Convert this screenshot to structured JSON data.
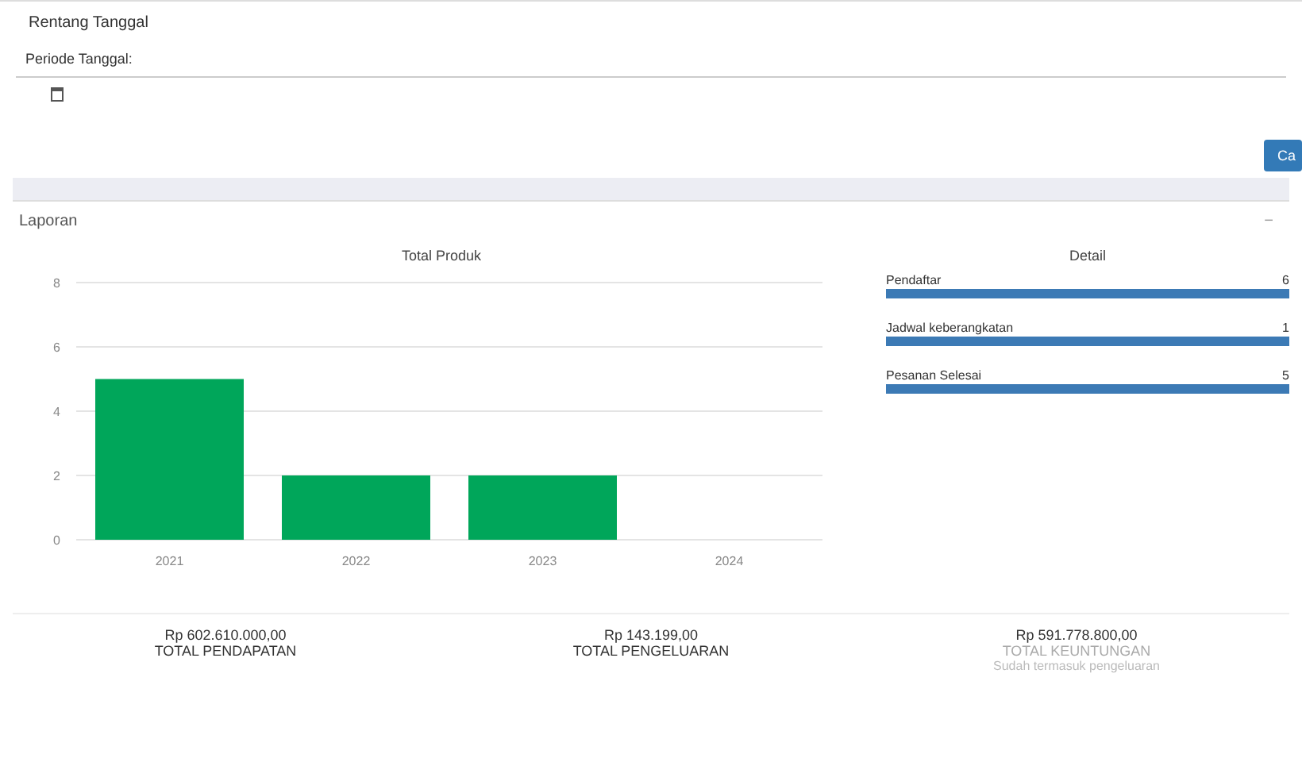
{
  "filter": {
    "title": "Rentang Tanggal",
    "label": "Periode Tanggal:",
    "button": "Ca"
  },
  "report": {
    "title": "Laporan",
    "collapse": "−",
    "chart": {
      "chart_data": {
        "type": "bar",
        "title": "Total Produk",
        "categories": [
          "2021",
          "2022",
          "2023",
          "2024"
        ],
        "values": [
          5,
          2,
          2,
          0
        ],
        "ylim": [
          0,
          8
        ],
        "yticks": [
          0,
          2,
          4,
          6,
          8
        ],
        "grid": true
      }
    },
    "detail": {
      "title": "Detail",
      "items": [
        {
          "label": "Pendaftar",
          "value": "6",
          "level": 1
        },
        {
          "label": "Jadwal keberangkatan",
          "value": "1",
          "level": 1
        },
        {
          "label": "Pesanan Selesai",
          "value": "5",
          "level": 1
        }
      ]
    },
    "totals": [
      {
        "amount": "Rp 602.610.000,00",
        "label": "TOTAL PENDAPATAN",
        "muted": false
      },
      {
        "amount": "Rp 143.199,00",
        "label": "TOTAL PENGELUARAN",
        "muted": false
      },
      {
        "amount": "Rp 591.778.800,00",
        "label": "TOTAL KEUNTUNGAN",
        "muted": true,
        "note": "Sudah termasuk pengeluaran"
      }
    ]
  }
}
